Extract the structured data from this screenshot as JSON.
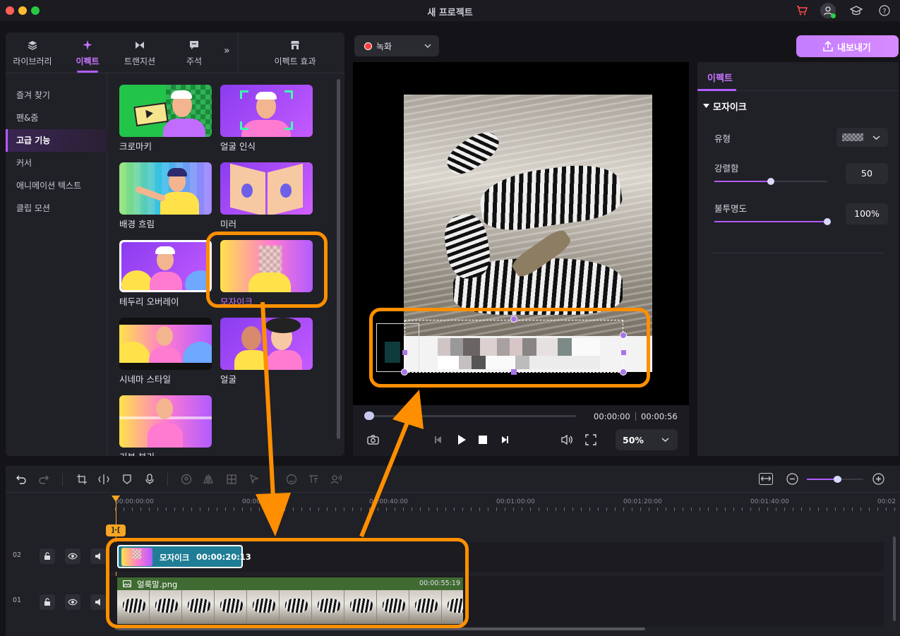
{
  "app": {
    "title": "새 프로젝트"
  },
  "tabs": [
    {
      "label": "라이브러리",
      "icon": "layers-icon"
    },
    {
      "label": "이펙트",
      "icon": "sparkle-icon"
    },
    {
      "label": "트랜지션",
      "icon": "transition-icon"
    },
    {
      "label": "주석",
      "icon": "annotation-icon"
    },
    {
      "label": "이펙트 효과",
      "icon": "store-icon"
    }
  ],
  "sidebar": {
    "items": [
      {
        "label": "즐겨 찾기"
      },
      {
        "label": "팬&줌"
      },
      {
        "label": "고급 기능"
      },
      {
        "label": "커서"
      },
      {
        "label": "애니메이션 텍스트"
      },
      {
        "label": "클립 모션"
      }
    ],
    "active": "고급 기능"
  },
  "effects": [
    {
      "label": "크로마키"
    },
    {
      "label": "얼굴 인식"
    },
    {
      "label": "배경 흐림"
    },
    {
      "label": "미러"
    },
    {
      "label": "테두리 오버레이"
    },
    {
      "label": "모자이크"
    },
    {
      "label": "시네마 스타일"
    },
    {
      "label": "얼굴"
    },
    {
      "label": "기본 분리"
    }
  ],
  "record": {
    "label": "녹화"
  },
  "export": {
    "label": "내보내기"
  },
  "player": {
    "current_time": "00:00:00",
    "total_time": "00:00:56",
    "zoom": "50%"
  },
  "properties": {
    "tab": "이펙트",
    "section": "모자이크",
    "type_label": "유형",
    "strength_label": "강렬함",
    "strength_value": "50",
    "strength": 0.5,
    "opacity_label": "불투명도",
    "opacity_value": "100%",
    "opacity": 1.0
  },
  "timeline": {
    "ruler": [
      "00:00:00:00",
      "00:00:20:00",
      "00:00:40:00",
      "00:01:00:00",
      "00:01:20:00",
      "00:01:40:00",
      "00:02"
    ],
    "tracks": [
      {
        "num": "02"
      },
      {
        "num": "01"
      }
    ],
    "effect_clip": {
      "name": "모자이크",
      "duration": "00:00:20:13"
    },
    "image_clip": {
      "name": "얼룩말.png",
      "duration": "00:00:55:19"
    }
  },
  "colors": {
    "accent": "#b15cff",
    "highlight": "#ff8f00",
    "effect_clip": "#1f7d95",
    "image_clip": "#3f6a31"
  }
}
